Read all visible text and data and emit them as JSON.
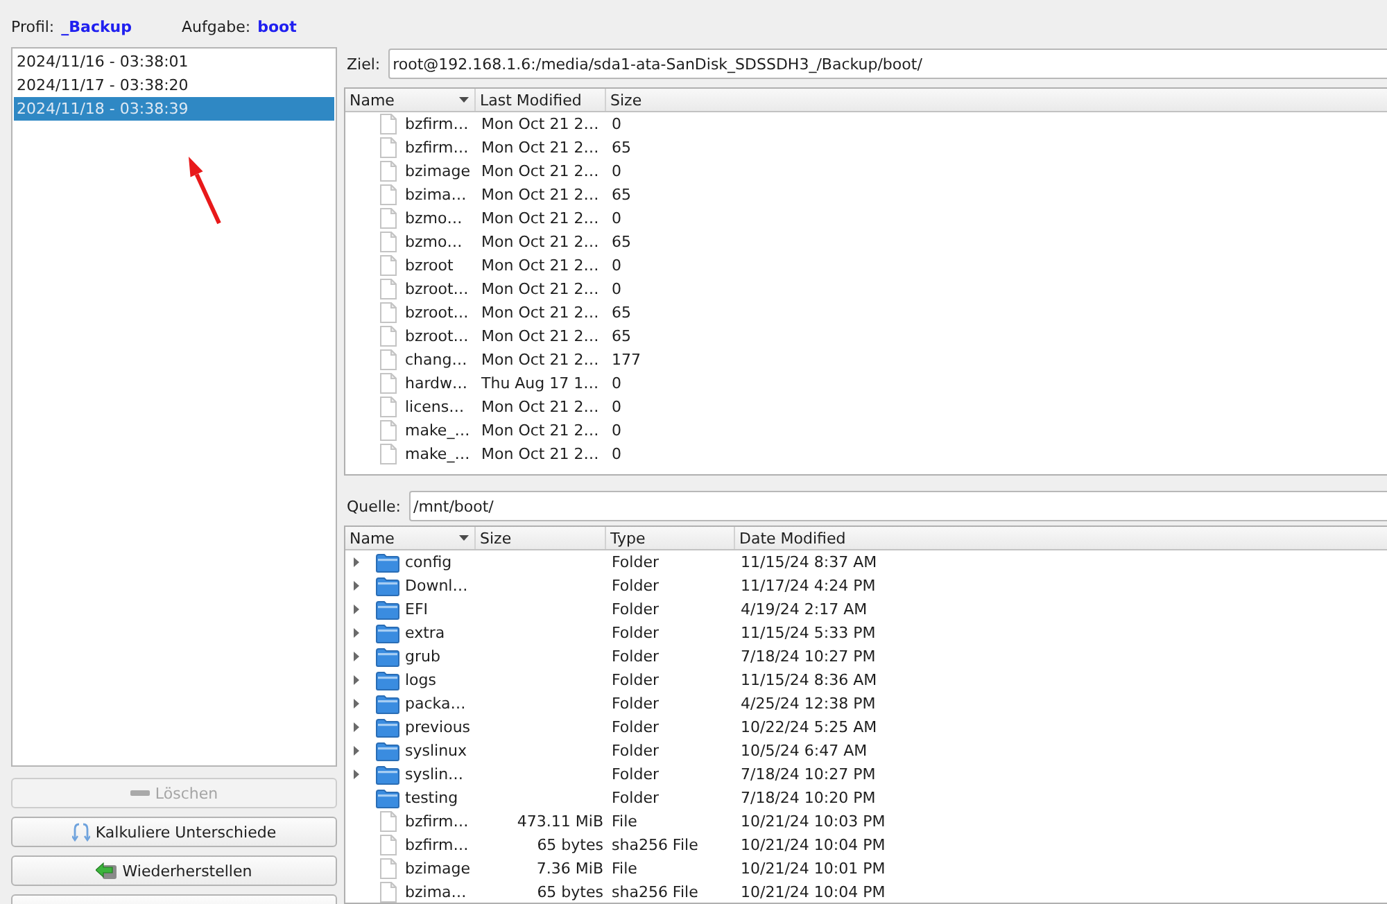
{
  "header": {
    "profile_label": "Profil:",
    "profile": "_Backup",
    "task_label": "Aufgabe:",
    "task": "boot"
  },
  "snapshots": [
    {
      "label": "2024/11/16 - 03:38:01",
      "selected": false
    },
    {
      "label": "2024/11/17 - 03:38:20",
      "selected": false
    },
    {
      "label": "2024/11/18 - 03:38:39",
      "selected": true
    }
  ],
  "buttons": [
    {
      "kind": "delete",
      "label": "Löschen",
      "disabled": true
    },
    {
      "kind": "compare",
      "label": "Kalkuliere Unterschiede",
      "disabled": false
    },
    {
      "kind": "restore",
      "label": "Wiederherstellen",
      "disabled": false
    },
    {
      "kind": "other",
      "disabled": false
    }
  ],
  "target": {
    "label": "Ziel:",
    "path": "root@192.168.1.6:/media/sda1-ata-SanDisk_SDSSDH3_/Backup/boot/"
  },
  "target_table": {
    "columns": [
      {
        "label": "Name",
        "sorted": true
      },
      {
        "label": "Last Modified",
        "sorted": false
      },
      {
        "label": "Size",
        "sorted": false
      }
    ],
    "rows": [
      {
        "name": "bzfirm…",
        "modified": "Mon Oct 21 2…",
        "size": "0"
      },
      {
        "name": "bzfirm…",
        "modified": "Mon Oct 21 2…",
        "size": "65"
      },
      {
        "name": "bzimage",
        "modified": "Mon Oct 21 2…",
        "size": "0"
      },
      {
        "name": "bzima…",
        "modified": "Mon Oct 21 2…",
        "size": "65"
      },
      {
        "name": "bzmo…",
        "modified": "Mon Oct 21 2…",
        "size": "0"
      },
      {
        "name": "bzmo…",
        "modified": "Mon Oct 21 2…",
        "size": "65"
      },
      {
        "name": "bzroot",
        "modified": "Mon Oct 21 2…",
        "size": "0"
      },
      {
        "name": "bzroot…",
        "modified": "Mon Oct 21 2…",
        "size": "0"
      },
      {
        "name": "bzroot…",
        "modified": "Mon Oct 21 2…",
        "size": "65"
      },
      {
        "name": "bzroot…",
        "modified": "Mon Oct 21 2…",
        "size": "65"
      },
      {
        "name": "chang…",
        "modified": "Mon Oct 21 2…",
        "size": "177"
      },
      {
        "name": "hardw…",
        "modified": "Thu Aug 17 1…",
        "size": "0"
      },
      {
        "name": "licens…",
        "modified": "Mon Oct 21 2…",
        "size": "0"
      },
      {
        "name": "make_…",
        "modified": "Mon Oct 21 2…",
        "size": "0"
      },
      {
        "name": "make_…",
        "modified": "Mon Oct 21 2…",
        "size": "0"
      }
    ]
  },
  "source": {
    "label": "Quelle:",
    "path": "/mnt/boot/"
  },
  "source_table": {
    "columns": [
      {
        "label": "Name",
        "sorted": true
      },
      {
        "label": "Size",
        "sorted": false
      },
      {
        "label": "Type",
        "sorted": false
      },
      {
        "label": "Date Modified",
        "sorted": false
      }
    ],
    "rows": [
      {
        "kind": "folder",
        "expandable": true,
        "name": "config",
        "type": "Folder",
        "modified": "11/15/24 8:37 AM"
      },
      {
        "kind": "folder",
        "expandable": true,
        "name": "Downl…",
        "type": "Folder",
        "modified": "11/17/24 4:24 PM"
      },
      {
        "kind": "folder",
        "expandable": true,
        "name": "EFI",
        "type": "Folder",
        "modified": "4/19/24 2:17 AM"
      },
      {
        "kind": "folder",
        "expandable": true,
        "name": "extra",
        "type": "Folder",
        "modified": "11/15/24 5:33 PM"
      },
      {
        "kind": "folder",
        "expandable": true,
        "name": "grub",
        "type": "Folder",
        "modified": "7/18/24 10:27 PM"
      },
      {
        "kind": "folder",
        "expandable": true,
        "name": "logs",
        "type": "Folder",
        "modified": "11/15/24 8:36 AM"
      },
      {
        "kind": "folder",
        "expandable": true,
        "name": "packa…",
        "type": "Folder",
        "modified": "4/25/24 12:38 PM"
      },
      {
        "kind": "folder",
        "expandable": true,
        "name": "previous",
        "type": "Folder",
        "modified": "10/22/24 5:25 AM"
      },
      {
        "kind": "folder",
        "expandable": true,
        "name": "syslinux",
        "type": "Folder",
        "modified": "10/5/24 6:47 AM"
      },
      {
        "kind": "folder",
        "expandable": true,
        "name": "syslin…",
        "type": "Folder",
        "modified": "7/18/24 10:27 PM"
      },
      {
        "kind": "folder",
        "expandable": false,
        "name": "testing",
        "type": "Folder",
        "modified": "7/18/24 10:20 PM"
      },
      {
        "kind": "file",
        "expandable": false,
        "name": "bzfirm…",
        "size": "473.11 MiB",
        "type": "File",
        "modified": "10/21/24 10:03 PM"
      },
      {
        "kind": "file",
        "expandable": false,
        "name": "bzfirm…",
        "size": "65 bytes",
        "type": "sha256 File",
        "modified": "10/21/24 10:04 PM"
      },
      {
        "kind": "file",
        "expandable": false,
        "name": "bzimage",
        "size": "7.36 MiB",
        "type": "File",
        "modified": "10/21/24 10:01 PM"
      },
      {
        "kind": "file",
        "expandable": false,
        "name": "bzima…",
        "size": "65 bytes",
        "type": "sha256 File",
        "modified": "10/21/24 10:04 PM"
      }
    ]
  }
}
